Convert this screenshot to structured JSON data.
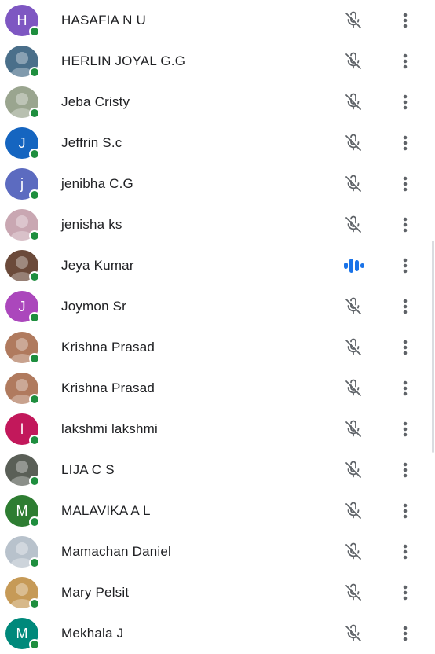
{
  "participants": [
    {
      "name": "HASAFIA N U",
      "avatar": {
        "type": "letter",
        "letter": "H",
        "color": "#7e57c2"
      },
      "mic": "muted"
    },
    {
      "name": "HERLIN JOYAL G.G",
      "avatar": {
        "type": "photo",
        "color": "#4a6f8a"
      },
      "mic": "muted"
    },
    {
      "name": "Jeba Cristy",
      "avatar": {
        "type": "photo",
        "color": "#9aa58f"
      },
      "mic": "muted"
    },
    {
      "name": "Jeffrin S.c",
      "avatar": {
        "type": "letter",
        "letter": "J",
        "color": "#1565c0"
      },
      "mic": "muted"
    },
    {
      "name": "jenibha C.G",
      "avatar": {
        "type": "letter",
        "letter": "j",
        "color": "#5c6bc0"
      },
      "mic": "muted"
    },
    {
      "name": "jenisha ks",
      "avatar": {
        "type": "photo",
        "color": "#c9a7b2"
      },
      "mic": "muted"
    },
    {
      "name": "Jeya Kumar",
      "avatar": {
        "type": "photo",
        "color": "#6b4a3a"
      },
      "mic": "speaking"
    },
    {
      "name": "Joymon Sr",
      "avatar": {
        "type": "letter",
        "letter": "J",
        "color": "#ab47bc"
      },
      "mic": "muted"
    },
    {
      "name": "Krishna Prasad",
      "avatar": {
        "type": "photo",
        "color": "#b07a5e"
      },
      "mic": "muted"
    },
    {
      "name": "Krishna Prasad",
      "avatar": {
        "type": "photo",
        "color": "#b07a5e"
      },
      "mic": "muted"
    },
    {
      "name": "lakshmi lakshmi",
      "avatar": {
        "type": "letter",
        "letter": "l",
        "color": "#c2185b"
      },
      "mic": "muted"
    },
    {
      "name": "LIJA C S",
      "avatar": {
        "type": "photo",
        "color": "#5a5f57"
      },
      "mic": "muted"
    },
    {
      "name": "MALAVIKA A L",
      "avatar": {
        "type": "letter",
        "letter": "M",
        "color": "#2e7d32"
      },
      "mic": "muted"
    },
    {
      "name": "Mamachan Daniel",
      "avatar": {
        "type": "photo",
        "color": "#b8c2cc"
      },
      "mic": "muted"
    },
    {
      "name": "Mary Pelsit",
      "avatar": {
        "type": "photo",
        "color": "#c69a57"
      },
      "mic": "muted"
    },
    {
      "name": "Mekhala J",
      "avatar": {
        "type": "letter",
        "letter": "M",
        "color": "#00897b"
      },
      "mic": "muted"
    }
  ],
  "colors": {
    "online_dot": "#1e8e3e",
    "muted_icon": "#5f6368",
    "speaking_icon": "#1a73e8",
    "text": "#202124"
  }
}
